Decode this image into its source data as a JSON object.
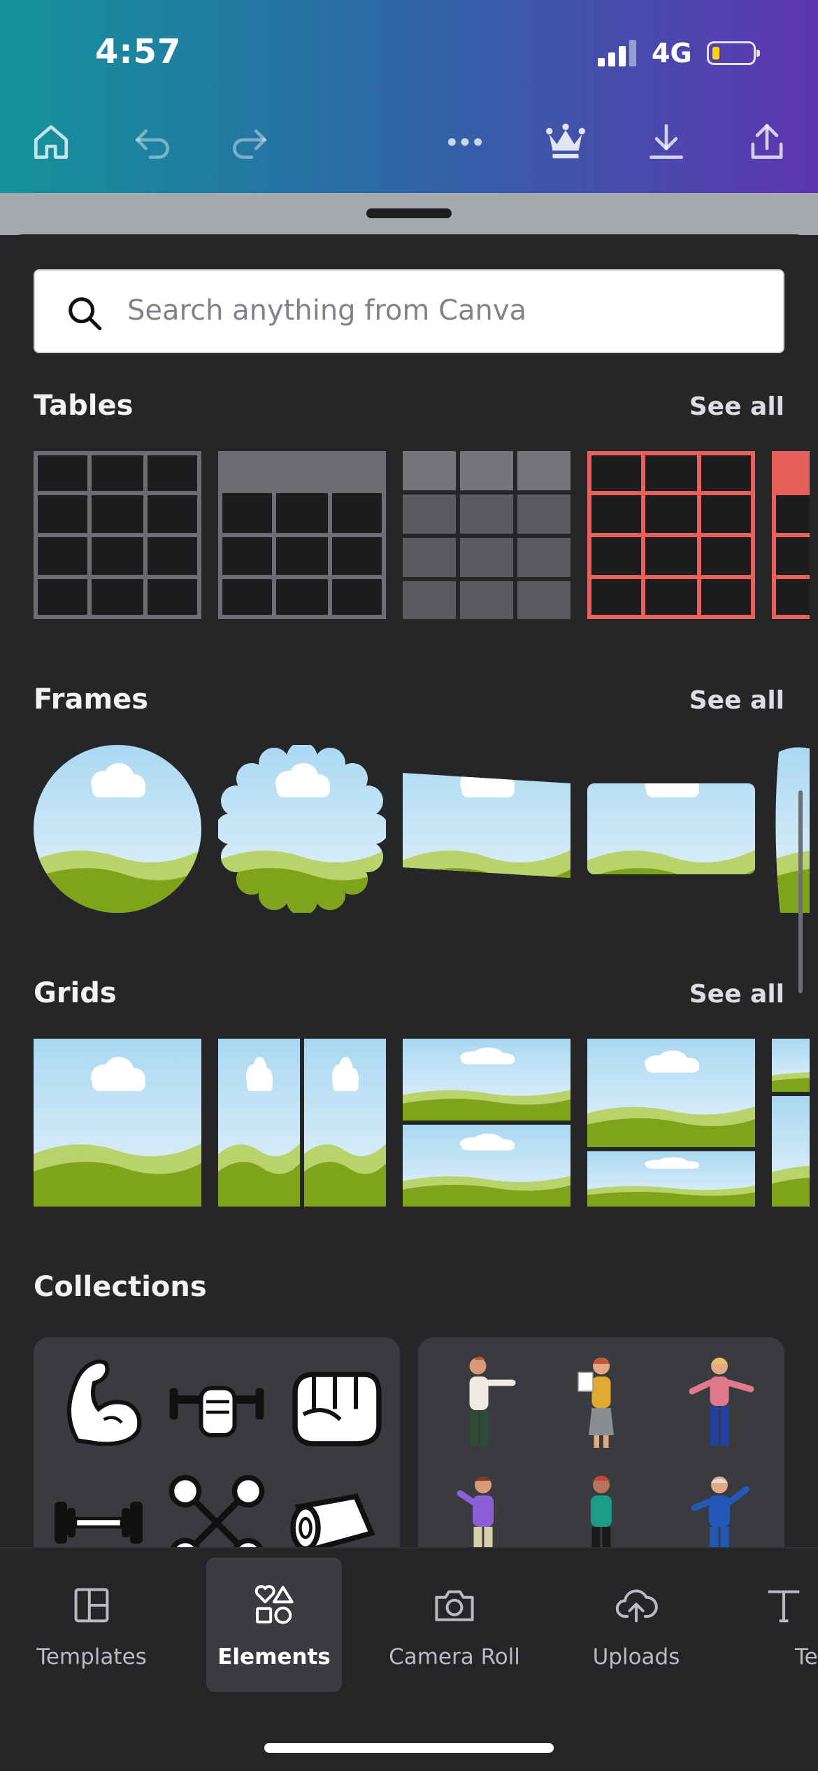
{
  "status_bar": {
    "time": "4:57",
    "network": "4G",
    "battery_color": "#ffd400"
  },
  "toolbar": {
    "icons": [
      "home-icon",
      "undo-icon",
      "redo-icon",
      "more-icon",
      "crown-icon",
      "download-icon",
      "share-icon"
    ]
  },
  "search": {
    "placeholder": "Search anything from Canva"
  },
  "sections": {
    "tables": {
      "title": "Tables",
      "see_all": "See all"
    },
    "frames": {
      "title": "Frames",
      "see_all": "See all"
    },
    "grids": {
      "title": "Grids",
      "see_all": "See all"
    },
    "collections": {
      "title": "Collections"
    }
  },
  "collections": {
    "fitness_items": [
      "flexed-arm-icon",
      "hand-dumbbell-icon",
      "fist-icon",
      "dumbbell-icon",
      "crossed-dumbbells-icon",
      "yoga-mat-icon"
    ],
    "people_items": [
      "person-pointing",
      "person-clipboard",
      "person-waving",
      "person-purple-shirt",
      "person-green-shirt",
      "person-blue-suit"
    ]
  },
  "bottom_nav": {
    "items": [
      {
        "label": "Templates",
        "icon": "templates-icon"
      },
      {
        "label": "Elements",
        "icon": "elements-icon",
        "active": true
      },
      {
        "label": "Camera Roll",
        "icon": "camera-icon"
      },
      {
        "label": "Uploads",
        "icon": "upload-cloud-icon"
      },
      {
        "label": "Te",
        "icon": "text-icon"
      }
    ]
  },
  "colors": {
    "accent_red": "#e8605a",
    "sheet": "#252628",
    "sky": "#c9e6f6",
    "grass": "#7fa41b"
  }
}
